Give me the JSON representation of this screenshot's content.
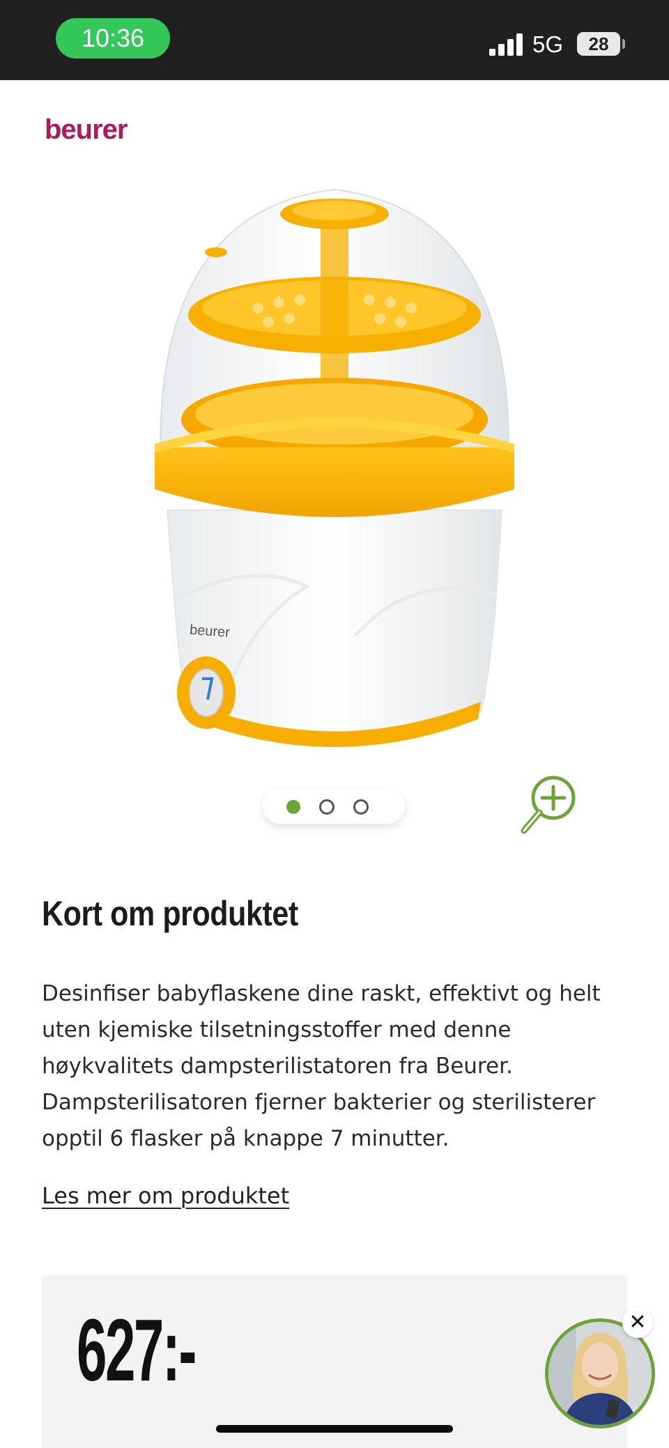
{
  "status_bar": {
    "time": "10:36",
    "network": "5G",
    "battery": "28",
    "signal_bars": 4,
    "time_pill_color": "#34c759"
  },
  "brand": {
    "logo_text": "beurer",
    "logo_color": "#b0185a",
    "device_label": "beurer"
  },
  "carousel": {
    "slides": 3,
    "active_index": 0,
    "active_color": "#6ea33a"
  },
  "zoom": {
    "icon": "zoom-in-icon"
  },
  "content": {
    "title": "Kort om produktet",
    "description": "Desinfiser babyflaskene dine raskt, effektivt og helt uten kjemiske tilsetningsstoffer med denne høykvalitets dampsterilistatoren fra Beurer. Dampsterilisatoren fjerner bakterier og sterilisterer opptil 6 flasker på knappe 7 minutter.",
    "read_more": "Les mer om produktet"
  },
  "price": {
    "value": "627:-"
  },
  "chat": {
    "close_label": "✕",
    "icon": "chat-agent-avatar"
  },
  "colors": {
    "accent_green": "#6ea33a",
    "product_yellow": "#f8b400"
  }
}
